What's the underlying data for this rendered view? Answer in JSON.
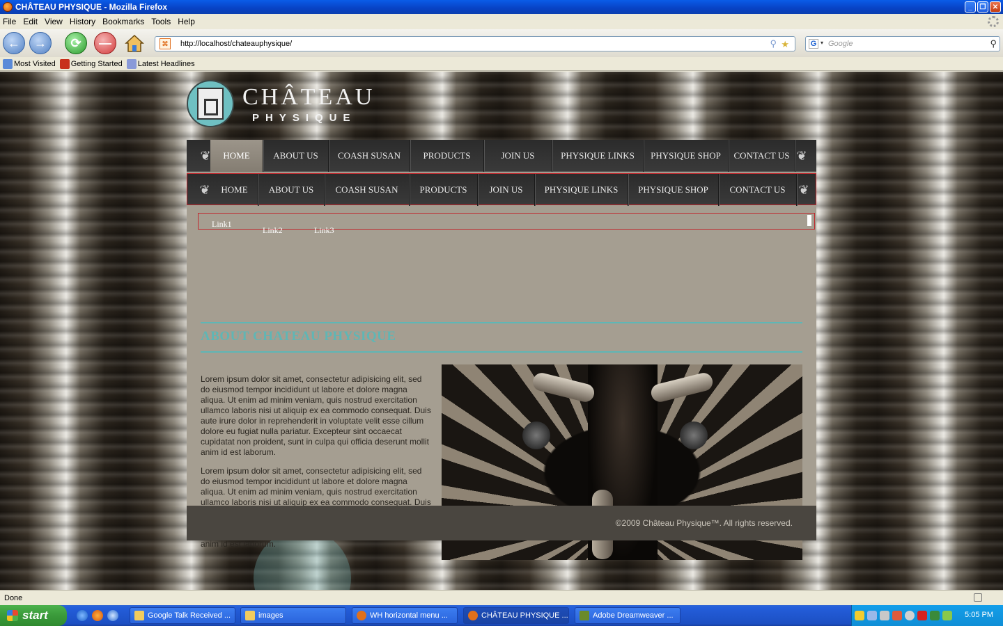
{
  "window": {
    "title": "CHÂTEAU PHYSIQUE - Mozilla Firefox"
  },
  "menu": [
    "File",
    "Edit",
    "View",
    "History",
    "Bookmarks",
    "Tools",
    "Help"
  ],
  "nav": {
    "url": "http://localhost/chateauphysique/",
    "search_placeholder": "Google"
  },
  "bookmarks": [
    "Most Visited",
    "Getting Started",
    "Latest Headlines"
  ],
  "site": {
    "logo_title": "CHÂTEAU",
    "logo_sub": "PHYSIQUE",
    "menu1": [
      "HOME",
      "ABOUT US",
      "COASH SUSAN",
      "PRODUCTS",
      "JOIN US",
      "PHYSIQUE LINKS",
      "PHYSIQUE SHOP",
      "CONTACT US"
    ],
    "menu2": [
      "HOME",
      "ABOUT US",
      "COASH SUSAN",
      "PRODUCTS",
      "JOIN US",
      "PHYSIQUE LINKS",
      "PHYSIQUE SHOP",
      "CONTACT US"
    ],
    "submenu": [
      "Link1",
      "Link2",
      "Link3"
    ],
    "heading": "ABOUT CHATEAU PHYSIQUE",
    "paragraphs": [
      "Lorem ipsum dolor sit amet, consectetur adipisicing elit, sed do eiusmod tempor incididunt ut labore et dolore magna aliqua. Ut enim ad minim veniam, quis nostrud exercitation ullamco laboris nisi ut aliquip ex ea commodo consequat. Duis aute irure dolor in reprehenderit in voluptate velit esse cillum dolore eu fugiat nulla pariatur. Excepteur sint occaecat cupidatat non proident, sunt in culpa qui officia deserunt mollit anim id est laborum.",
      "Lorem ipsum dolor sit amet, consectetur adipisicing elit, sed do eiusmod tempor incididunt ut labore et dolore magna aliqua. Ut enim ad minim veniam, quis nostrud exercitation ullamco laboris nisi ut aliquip ex ea commodo consequat. Duis aute irure dolor in reprehenderit in voluptate velit esse cillum dolore eu fugiat nulla pariatur. Excepteur sint occaecat cupidatat non proident, sunt in culpa qui officia deserunt mollit anim id est laborum."
    ],
    "footer": "©2009 Château Physique™. All rights reserved.",
    "accent_color": "#5fb6b5"
  },
  "status": {
    "text": "Done"
  },
  "taskbar": {
    "start": "start",
    "tasks": [
      "Google Talk Received ...",
      "images",
      "WH horizontal menu ...",
      "CHÂTEAU PHYSIQUE ...",
      "Adobe Dreamweaver ..."
    ],
    "clock": "5:05 PM"
  }
}
